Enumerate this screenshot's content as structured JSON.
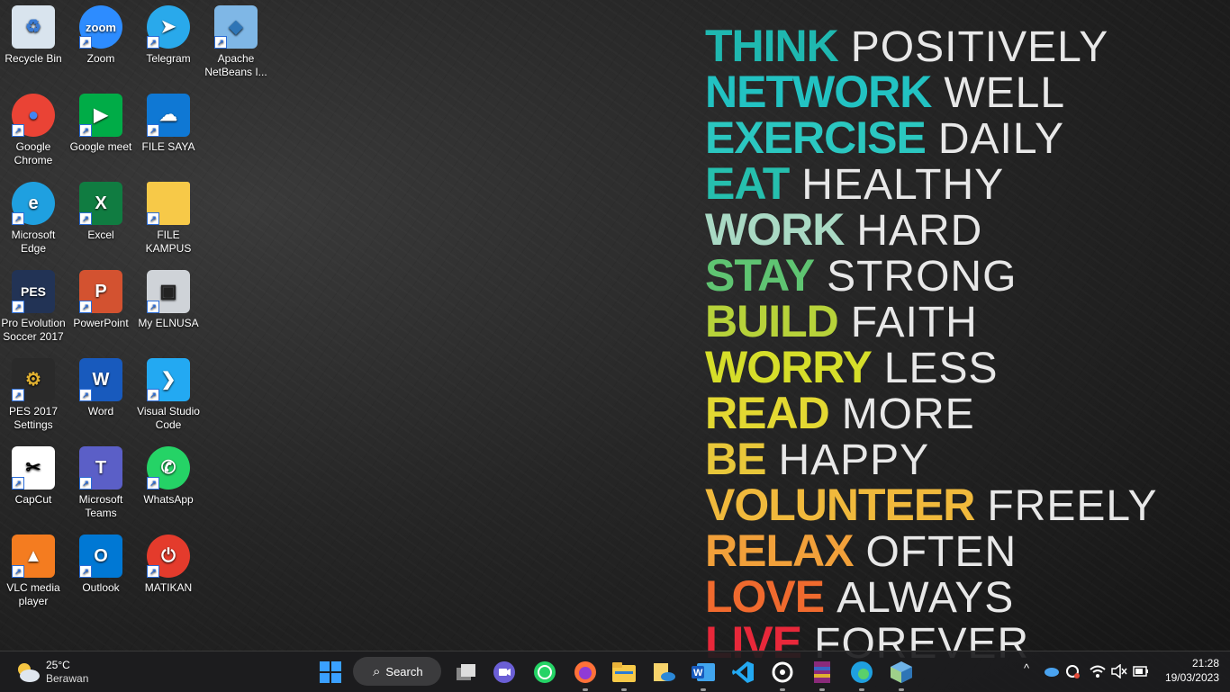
{
  "desktop_icons": [
    {
      "label": "Recycle Bin",
      "icon": "recycle-bin-icon"
    },
    {
      "label": "Zoom",
      "icon": "zoom-icon"
    },
    {
      "label": "Telegram",
      "icon": "telegram-icon"
    },
    {
      "label": "Apache NetBeans I...",
      "icon": "netbeans-icon"
    },
    {
      "label": "Google Chrome",
      "icon": "chrome-icon"
    },
    {
      "label": "Google meet",
      "icon": "google-meet-icon"
    },
    {
      "label": "FILE SAYA",
      "icon": "onedrive-icon"
    },
    {
      "label": "Microsoft Edge",
      "icon": "edge-icon"
    },
    {
      "label": "Excel",
      "icon": "excel-icon"
    },
    {
      "label": "FILE KAMPUS",
      "icon": "folder-icon"
    },
    {
      "label": "Pro Evolution Soccer 2017",
      "icon": "pes-icon"
    },
    {
      "label": "PowerPoint",
      "icon": "powerpoint-icon"
    },
    {
      "label": "My ELNUSA",
      "icon": "monitor-icon"
    },
    {
      "label": "PES 2017 Settings",
      "icon": "pes-settings-icon"
    },
    {
      "label": "Word",
      "icon": "word-icon"
    },
    {
      "label": "Visual Studio Code",
      "icon": "vscode-icon"
    },
    {
      "label": "CapCut",
      "icon": "capcut-icon"
    },
    {
      "label": "Microsoft Teams",
      "icon": "teams-icon"
    },
    {
      "label": "WhatsApp",
      "icon": "whatsapp-icon"
    },
    {
      "label": "VLC media player",
      "icon": "vlc-icon"
    },
    {
      "label": "Outlook",
      "icon": "outlook-icon"
    },
    {
      "label": "MATIKAN",
      "icon": "power-icon"
    }
  ],
  "wallpaper_quotes": [
    {
      "bold": "THINK",
      "thin": "POSITIVELY",
      "color": "#1fb8b0"
    },
    {
      "bold": "NETWORK",
      "thin": "WELL",
      "color": "#22c2c2"
    },
    {
      "bold": "EXERCISE",
      "thin": "DAILY",
      "color": "#2bc7c0"
    },
    {
      "bold": "EAT",
      "thin": "HEALTHY",
      "color": "#26bfae"
    },
    {
      "bold": "WORK",
      "thin": "HARD",
      "color": "#a9d9c4"
    },
    {
      "bold": "STAY",
      "thin": "STRONG",
      "color": "#5fc472"
    },
    {
      "bold": "BUILD",
      "thin": "FAITH",
      "color": "#b7d23a"
    },
    {
      "bold": "WORRY",
      "thin": "LESS",
      "color": "#d6de2a"
    },
    {
      "bold": "READ",
      "thin": "MORE",
      "color": "#e3d832"
    },
    {
      "bold": "BE",
      "thin": "HAPPY",
      "color": "#e8c73a"
    },
    {
      "bold": "VOLUNTEER",
      "thin": "FREELY",
      "color": "#f0b93c"
    },
    {
      "bold": "RELAX",
      "thin": "OFTEN",
      "color": "#f1a03a"
    },
    {
      "bold": "LOVE",
      "thin": "ALWAYS",
      "color": "#f06a2e"
    },
    {
      "bold": "LIVE",
      "thin": "FOREVER",
      "color": "#e8283a"
    }
  ],
  "weather": {
    "temp": "25°C",
    "condition": "Berawan"
  },
  "taskbar": {
    "search_label": "Search",
    "apps": [
      "start-icon",
      "search",
      "task-view-icon",
      "teams-chat-icon",
      "whatsapp-icon",
      "firefox-icon",
      "file-explorer-icon",
      "onedrive-folder-icon",
      "word-icon",
      "vscode-icon",
      "obs-icon",
      "winrar-icon",
      "edge-icon",
      "netbeans-icon"
    ]
  },
  "clock": {
    "time": "21:28",
    "date": "19/03/2023"
  }
}
